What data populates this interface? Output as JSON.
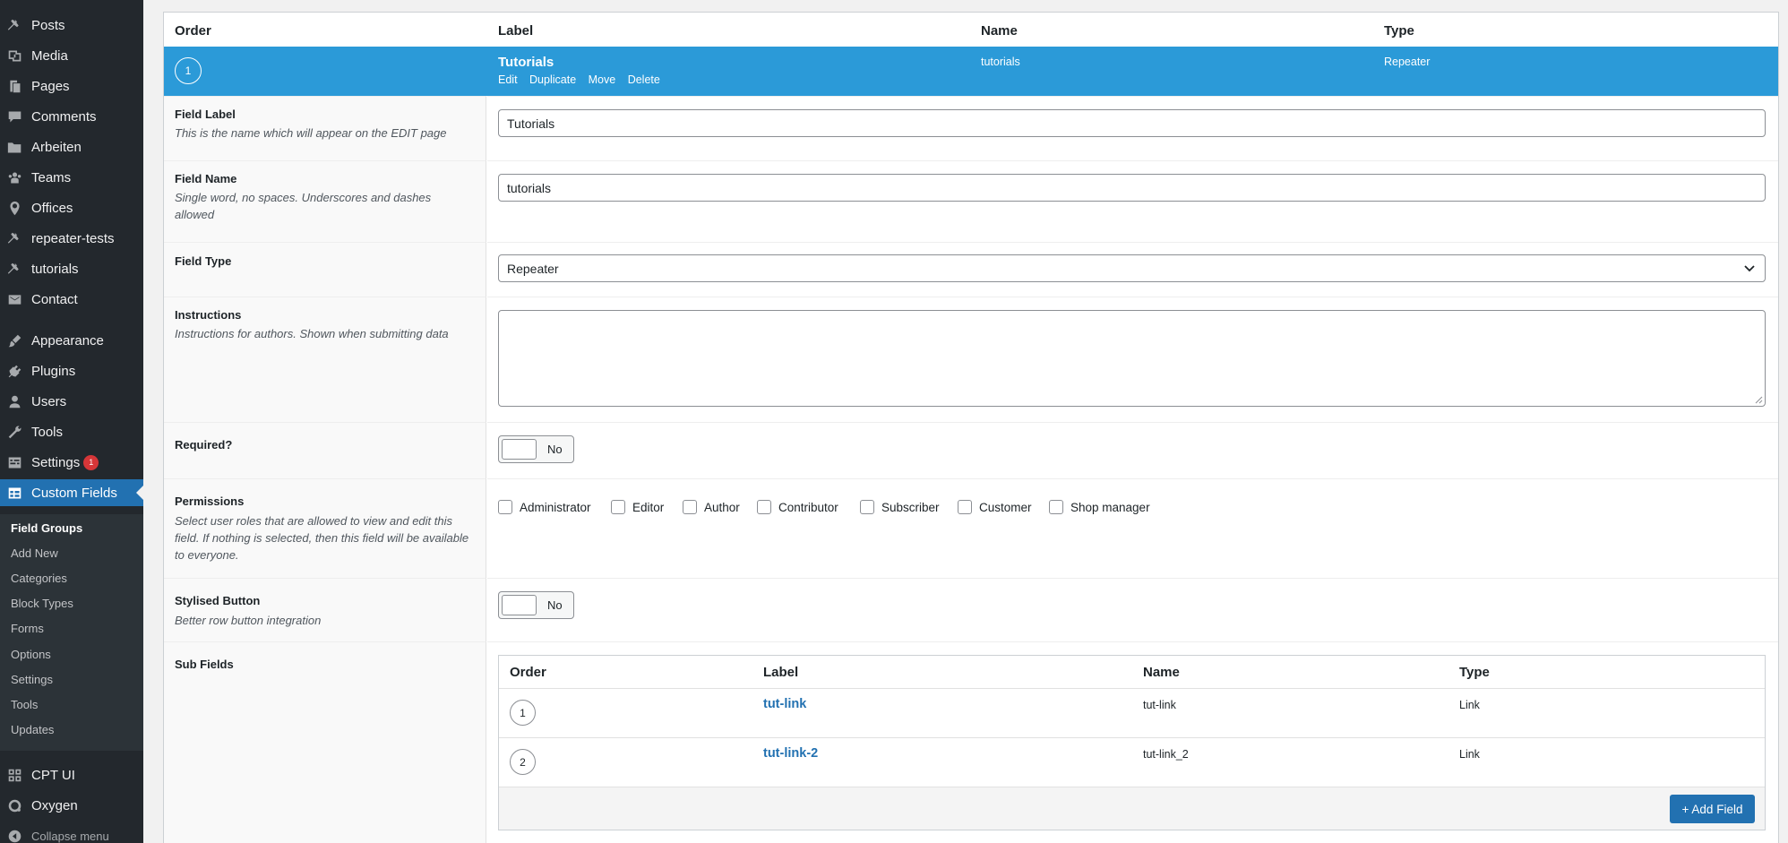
{
  "sidebar": {
    "items": [
      {
        "label": "Posts",
        "icon": "pin-icon"
      },
      {
        "label": "Media",
        "icon": "media-icon"
      },
      {
        "label": "Pages",
        "icon": "pages-icon"
      },
      {
        "label": "Comments",
        "icon": "comment-icon"
      },
      {
        "label": "Arbeiten",
        "icon": "folder-icon"
      },
      {
        "label": "Teams",
        "icon": "groups-icon"
      },
      {
        "label": "Offices",
        "icon": "location-icon"
      },
      {
        "label": "repeater-tests",
        "icon": "pin-icon"
      },
      {
        "label": "tutorials",
        "icon": "pin-icon"
      },
      {
        "label": "Contact",
        "icon": "email-icon"
      },
      {
        "label": "Appearance",
        "icon": "brush-icon"
      },
      {
        "label": "Plugins",
        "icon": "plugin-icon"
      },
      {
        "label": "Users",
        "icon": "user-icon"
      },
      {
        "label": "Tools",
        "icon": "wrench-icon"
      },
      {
        "label": "Settings",
        "icon": "settings-icon",
        "badge": "1"
      },
      {
        "label": "Custom Fields",
        "icon": "table-icon",
        "active": true
      }
    ],
    "submenu": [
      "Field Groups",
      "Add New",
      "Categories",
      "Block Types",
      "Forms",
      "Options",
      "Settings",
      "Tools",
      "Updates"
    ],
    "bottom": [
      {
        "label": "CPT UI",
        "icon": "grid-icon"
      },
      {
        "label": "Oxygen",
        "icon": "oxygen-icon"
      }
    ],
    "collapse_label": "Collapse menu"
  },
  "table": {
    "headers": {
      "order": "Order",
      "label": "Label",
      "name": "Name",
      "type": "Type"
    }
  },
  "field": {
    "order": "1",
    "label": "Tutorials",
    "name": "tutorials",
    "type": "Repeater",
    "actions": [
      "Edit",
      "Duplicate",
      "Move",
      "Delete"
    ]
  },
  "settings": {
    "field_label": {
      "title": "Field Label",
      "desc": "This is the name which will appear on the EDIT page",
      "value": "Tutorials"
    },
    "field_name": {
      "title": "Field Name",
      "desc": "Single word, no spaces. Underscores and dashes allowed",
      "value": "tutorials"
    },
    "field_type": {
      "title": "Field Type",
      "value": "Repeater"
    },
    "instructions": {
      "title": "Instructions",
      "desc": "Instructions for authors. Shown when submitting data",
      "value": ""
    },
    "required": {
      "title": "Required?",
      "toggle": "No"
    },
    "permissions": {
      "title": "Permissions",
      "desc": "Select user roles that are allowed to view and edit this field. If nothing is selected, then this field will be available to everyone.",
      "roles": [
        "Administrator",
        "Editor",
        "Author",
        "Contributor",
        "Subscriber",
        "Customer",
        "Shop manager"
      ]
    },
    "stylised_button": {
      "title": "Stylised Button",
      "desc": "Better row button integration",
      "toggle": "No"
    },
    "sub_fields": {
      "title": "Sub Fields"
    }
  },
  "subfields": {
    "headers": {
      "order": "Order",
      "label": "Label",
      "name": "Name",
      "type": "Type"
    },
    "rows": [
      {
        "order": "1",
        "label": "tut-link",
        "name": "tut-link",
        "type": "Link"
      },
      {
        "order": "2",
        "label": "tut-link-2",
        "name": "tut-link_2",
        "type": "Link"
      }
    ],
    "add_button": "+ Add Field"
  },
  "colors": {
    "sidebar": "#23282d",
    "active": "#2271b1",
    "field_row": "#2b9ad8",
    "link": "#2271b1"
  }
}
